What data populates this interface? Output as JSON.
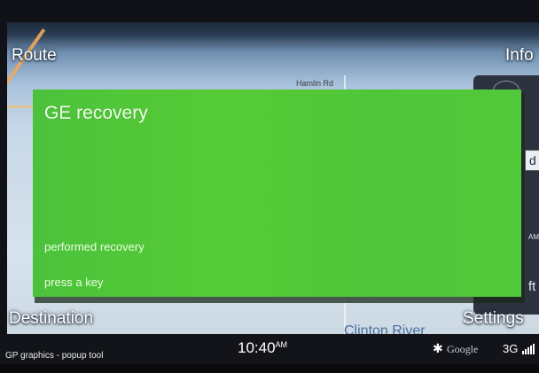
{
  "screen": {
    "corners": {
      "route": "Route",
      "info": "Info",
      "destination": "Destination",
      "settings": "Settings"
    },
    "map": {
      "road_label": "Hamlin Rd",
      "river_label": "Clinton River"
    },
    "right_panel": {
      "field_d": "d",
      "field_am": "AM",
      "field_ft": "ft"
    }
  },
  "popup": {
    "title": "GE recovery",
    "lines": [
      "performed recovery",
      "press a key"
    ],
    "background_color": "#52c83a"
  },
  "status_bar": {
    "left_text": "GP graphics - popup tool",
    "time": "10:40",
    "ampm": "AM",
    "bluetooth_icon": "bluetooth-icon",
    "google_label": "Google",
    "network": "3G",
    "signal_icon": "signal-icon"
  }
}
